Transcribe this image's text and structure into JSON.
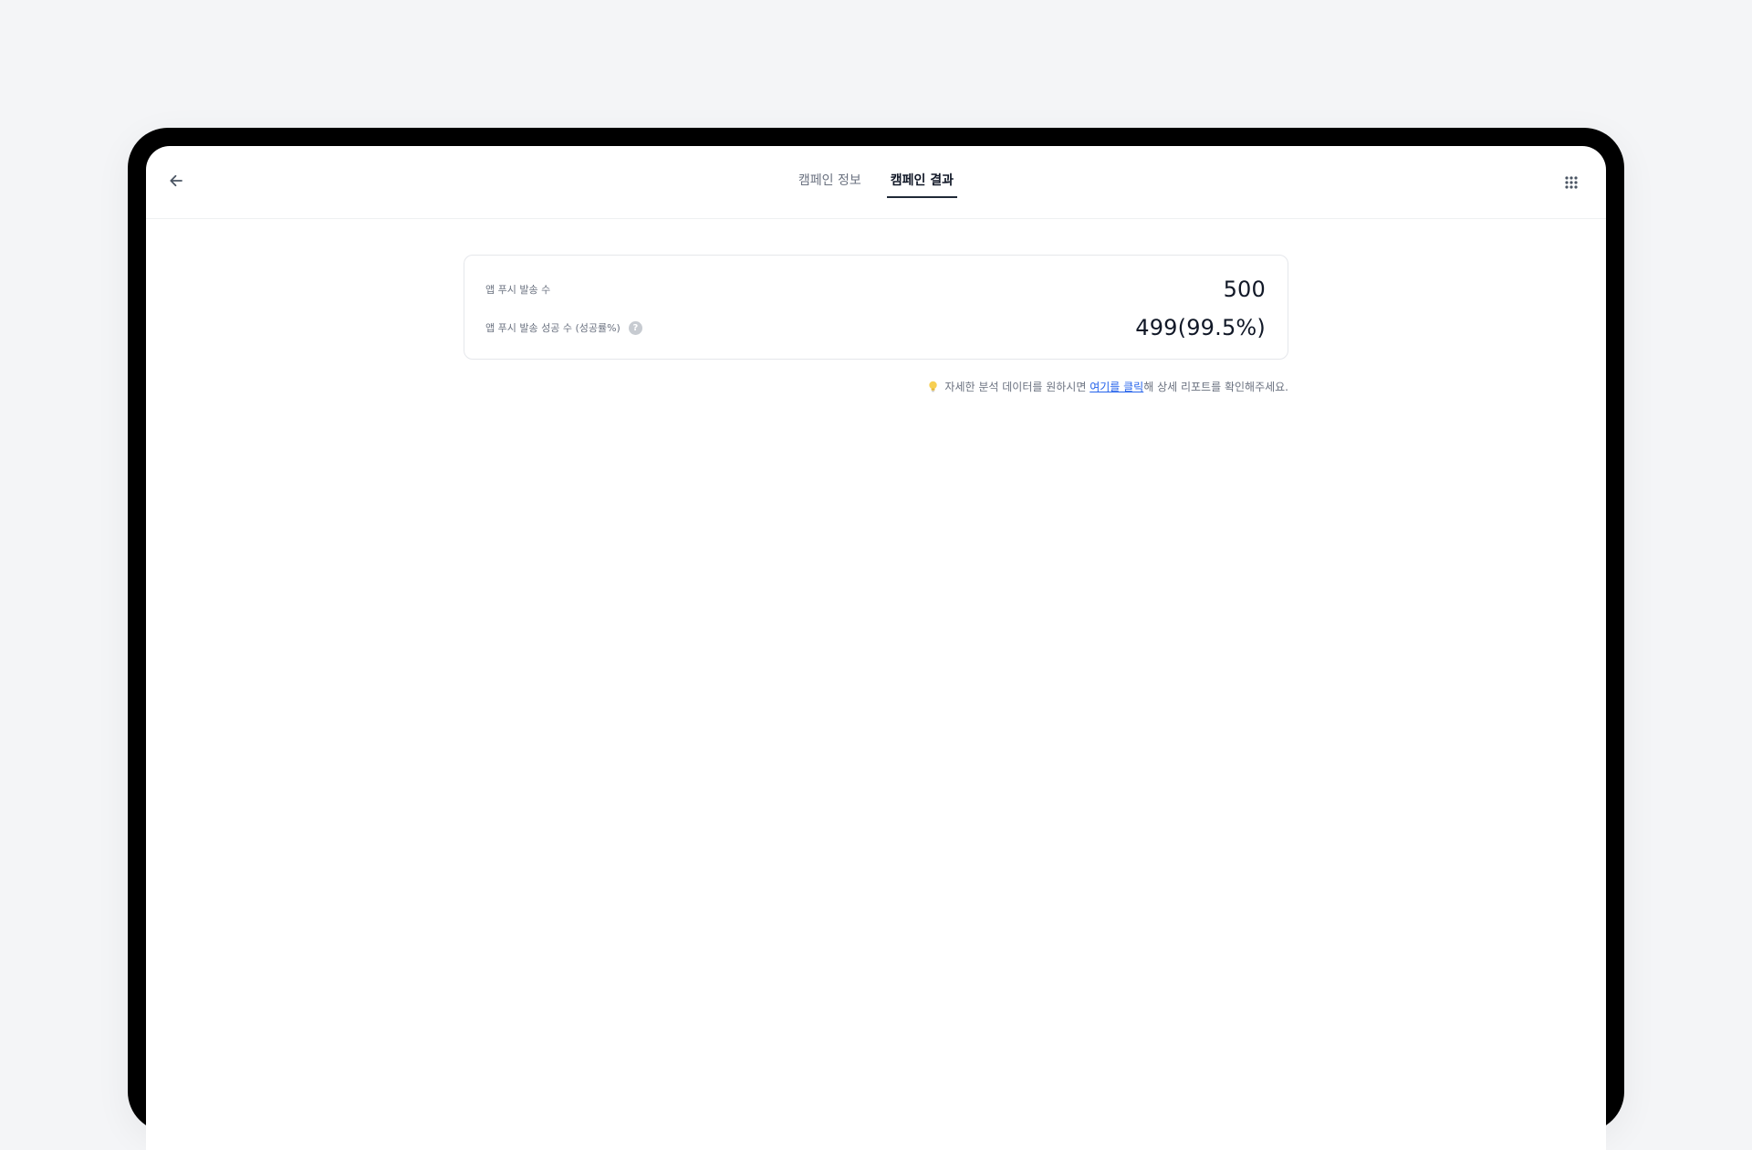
{
  "nav": {
    "back_icon": "arrow-left-icon",
    "tabs": [
      {
        "label": "캠페인 정보",
        "active": false
      },
      {
        "label": "캠페인 결과",
        "active": true
      }
    ],
    "apps_icon": "grid-dots-icon"
  },
  "stats": {
    "sent_label": "앱 푸시 발송 수",
    "sent_value": "500",
    "success_label": "앱 푸시 발송 성공 수 (성공률%)",
    "success_help": "?",
    "success_value": "499(99.5%)"
  },
  "hint": {
    "icon": "lightbulb-icon",
    "text_before": "자세한 분석 데이터를 원하시면 ",
    "link_text": "여기를 클릭",
    "text_after": "해 상세 리포트를 확인해주세요."
  },
  "colors": {
    "background": "#f4f5f7",
    "link": "#2563eb",
    "active_tab": "#111827",
    "bulb": "#f5c542"
  }
}
